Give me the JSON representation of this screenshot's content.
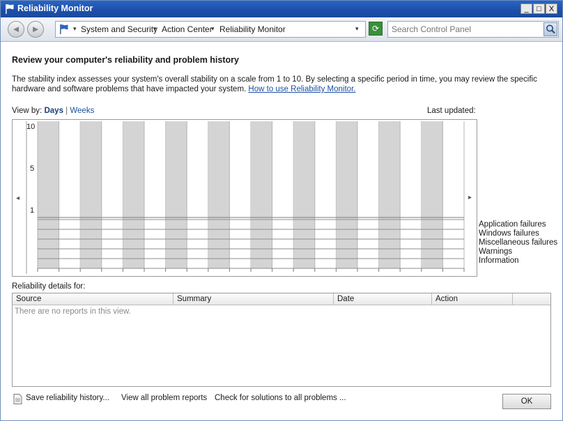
{
  "window": {
    "title": "Reliability Monitor",
    "minimize": "_",
    "maximize": "□",
    "close": "X"
  },
  "address": {
    "back": "◄",
    "forward": "►",
    "crumbs": [
      "System and Security",
      "Action Center",
      "Reliability Monitor"
    ],
    "separator": "▾",
    "refresh": "⟳",
    "search_placeholder": "Search Control Panel"
  },
  "content": {
    "heading": "Review your computer's reliability and problem history",
    "description": "The stability index assesses your system's overall stability on a scale from 1 to 10. By selecting a specific period in time, you may review the specific hardware and software problems that have impacted your system.",
    "help_link": "How to use Reliability Monitor.",
    "view_by_label": "View by:",
    "view_days": "Days",
    "view_divider": "|",
    "view_weeks": "Weeks",
    "last_updated": "Last updated:"
  },
  "chart_data": {
    "type": "table",
    "y_ticks": [
      "10",
      "5",
      "1"
    ],
    "columns": 20,
    "shaded_pattern": "alternate",
    "rows": [
      "Application failures",
      "Windows failures",
      "Miscellaneous failures",
      "Warnings",
      "Information"
    ],
    "scroll_left": "◂",
    "scroll_right": "▸"
  },
  "details": {
    "label": "Reliability details for:",
    "columns": [
      "Source",
      "Summary",
      "Date",
      "Action"
    ],
    "empty_text": "There are no reports in this view."
  },
  "footer": {
    "save_history": "Save reliability history...",
    "view_all": "View all problem reports",
    "check_solutions": "Check for solutions to all problems ...",
    "ok": "OK"
  },
  "colors": {
    "title_bar": "#1c4fa8",
    "shaded_column": "#d4d4d4",
    "link": "#1a4fa0"
  }
}
